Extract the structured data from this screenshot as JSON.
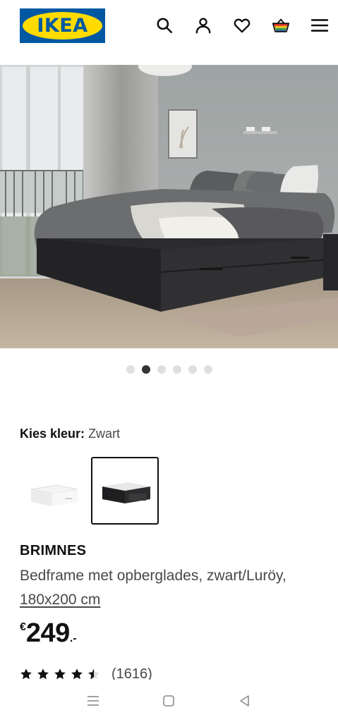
{
  "header": {
    "logo_text": "IKEA",
    "icons": [
      "search-icon",
      "user-icon",
      "heart-icon",
      "basket-icon",
      "menu-icon"
    ]
  },
  "carousel": {
    "total_slides": 6,
    "active_index": 1
  },
  "color_picker": {
    "label": "Kies kleur:",
    "selected_value": "Zwart",
    "options": [
      "wit",
      "zwart"
    ],
    "selected_index": 1
  },
  "product": {
    "name": "BRIMNES",
    "description": "Bedframe met opberglades, zwart/Luröy,",
    "size": "180x200 cm",
    "price_currency": "€",
    "price_integer": "249",
    "price_decimal": ".-",
    "rating_value": 4.5,
    "rating_max": 5,
    "review_count": "(1616)"
  },
  "nav_bar": {
    "icons": [
      "recent-apps-icon",
      "home-icon",
      "back-icon"
    ]
  },
  "colors": {
    "brand_blue": "#0058a3",
    "brand_yellow": "#ffdb00",
    "text_primary": "#111111",
    "text_secondary": "#484848",
    "dot_active": "#333333",
    "dot_inactive": "#dfdfdf"
  }
}
